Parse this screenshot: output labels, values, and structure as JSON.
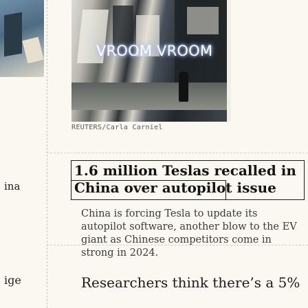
{
  "hero": {
    "sign_text": "VROOM VROOM",
    "credit": "REUTERS/Carla Carniel"
  },
  "left_column": {
    "word_one": "ina",
    "word_two": "ige"
  },
  "article": {
    "headline": "1.6 million Teslas recalled in China over autopilot issue",
    "headline_line1": "1.6 million Teslas recalled in",
    "headline_line2": "China over autopilot issue",
    "summary": "China is forcing Tesla to update its autopilot software, another blow to the EV giant as Chinese competitors come in strong in 2024."
  },
  "next_article": {
    "headline": "Researchers think there’s a 5%"
  }
}
